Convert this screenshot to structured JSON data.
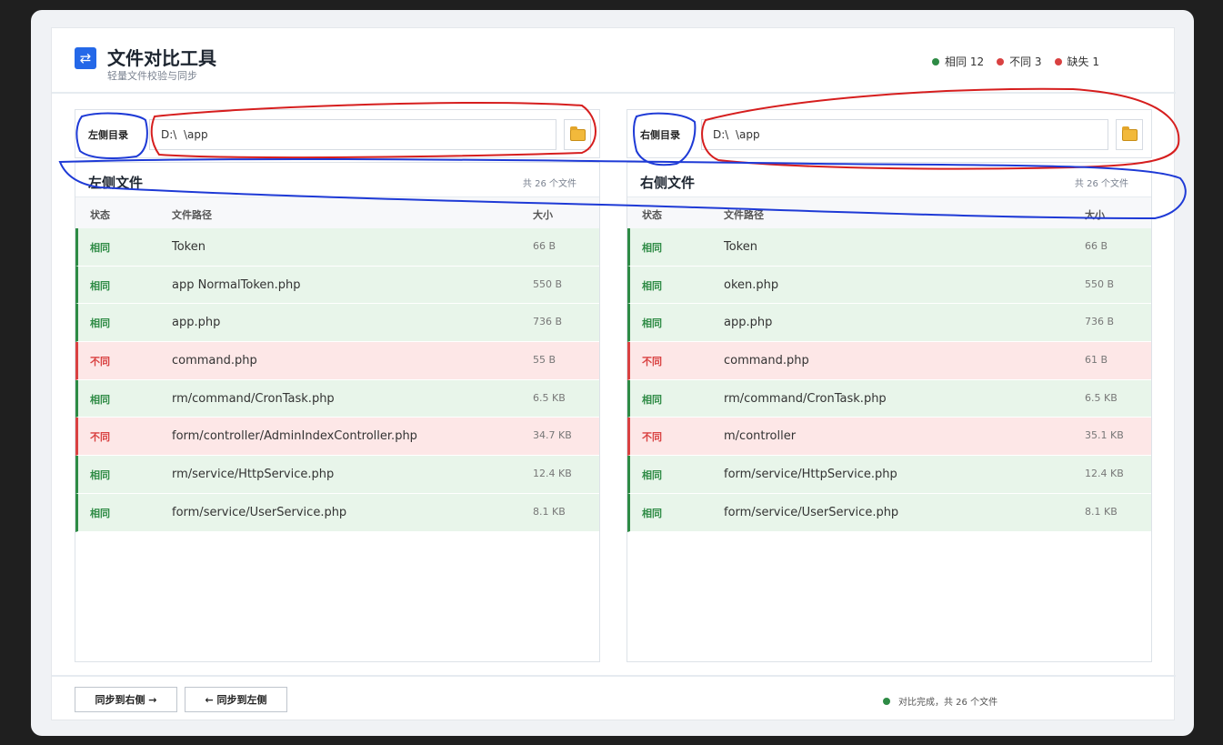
{
  "app": {
    "title": "文件对比工具",
    "subtitle": "轻量文件校验与同步",
    "logo_icon": "swap-arrows-icon"
  },
  "stats": [
    {
      "label": "相同 12",
      "color": "#2e8b45"
    },
    {
      "label": "不同 3",
      "color": "#d94141"
    },
    {
      "label": "缺失 1",
      "color": "#d94141"
    }
  ],
  "left": {
    "dir_label": "左侧目录",
    "dir_value": "D:\\  \\app",
    "list_title": "左侧文件",
    "count": "共 26 个文件",
    "columns": {
      "status": "状态",
      "path": "文件路径",
      "size": "大小"
    },
    "rows": [
      {
        "status": "相同",
        "kind": "same",
        "path": "Token",
        "size": "66 B"
      },
      {
        "status": "相同",
        "kind": "same",
        "path": "app NormalToken.php",
        "size": "550 B"
      },
      {
        "status": "相同",
        "kind": "same",
        "path": "app.php",
        "size": "736 B"
      },
      {
        "status": "不同",
        "kind": "diff",
        "path": "command.php",
        "size": "55 B"
      },
      {
        "status": "相同",
        "kind": "same",
        "path": "rm/command/CronTask.php",
        "size": "6.5 KB"
      },
      {
        "status": "不同",
        "kind": "diff",
        "path": "form/controller/AdminIndexController.php",
        "size": "34.7 KB"
      },
      {
        "status": "相同",
        "kind": "same",
        "path": "rm/service/HttpService.php",
        "size": "12.4 KB"
      },
      {
        "status": "相同",
        "kind": "same",
        "path": "form/service/UserService.php",
        "size": "8.1 KB"
      }
    ]
  },
  "right": {
    "dir_label": "右侧目录",
    "dir_value": "D:\\  \\app",
    "list_title": "右侧文件",
    "count": "共 26 个文件",
    "columns": {
      "status": "状态",
      "path": "文件路径",
      "size": "大小"
    },
    "rows": [
      {
        "status": "相同",
        "kind": "same",
        "path": "Token",
        "size": "66 B"
      },
      {
        "status": "相同",
        "kind": "same",
        "path": "oken.php",
        "size": "550 B"
      },
      {
        "status": "相同",
        "kind": "same",
        "path": "app.php",
        "size": "736 B"
      },
      {
        "status": "不同",
        "kind": "diff",
        "path": "command.php",
        "size": "61 B"
      },
      {
        "status": "相同",
        "kind": "same",
        "path": "rm/command/CronTask.php",
        "size": "6.5 KB"
      },
      {
        "status": "不同",
        "kind": "diff",
        "path": "m/controller",
        "size": "35.1 KB"
      },
      {
        "status": "相同",
        "kind": "same",
        "path": "form/service/HttpService.php",
        "size": "12.4 KB"
      },
      {
        "status": "相同",
        "kind": "same",
        "path": "form/service/UserService.php",
        "size": "8.1 KB"
      }
    ]
  },
  "footer": {
    "sync_right": "同步到右侧 →",
    "sync_left": "← 同步到左侧",
    "status": "对比完成，共 26 个文件",
    "status_color": "#2e8b45"
  }
}
